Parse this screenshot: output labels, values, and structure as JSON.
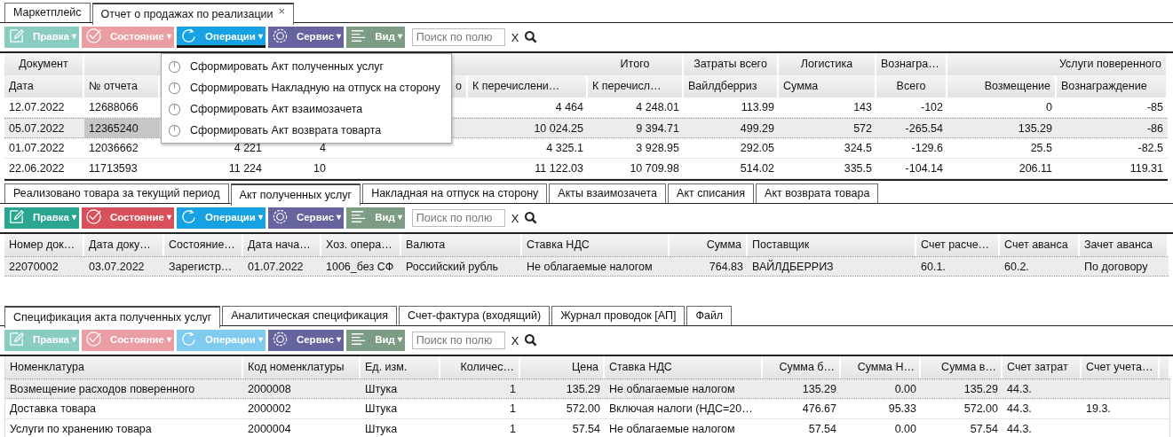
{
  "tabs": [
    {
      "label": "Маркетплейс",
      "selected": false
    },
    {
      "label": "Отчет о продажах по реализации",
      "selected": true,
      "close": "×"
    }
  ],
  "panels": [
    {
      "toolbar": {
        "buttons": [
          {
            "kind": "edit",
            "label": "Правка",
            "caret": "▾",
            "disabled": true,
            "expanded": false
          },
          {
            "kind": "status",
            "label": "Состояние",
            "caret": "▾",
            "disabled": true,
            "expanded": false
          },
          {
            "kind": "operations",
            "label": "Операции",
            "caret": "▾",
            "disabled": false,
            "expanded": true
          },
          {
            "kind": "service",
            "label": "Сервис",
            "caret": "▾",
            "disabled": false,
            "expanded": false
          },
          {
            "kind": "view",
            "label": "Вид",
            "caret": "▾",
            "disabled": false,
            "expanded": false
          }
        ],
        "search": {
          "placeholder": "Поиск по полю",
          "clear": "X"
        }
      },
      "menu": [
        "Сформировать Акт полученных услуг",
        "Сформировать Накладную на отпуск на сторону",
        "Сформировать Акт взаимозачета",
        "Сформировать Акт возврата товарта"
      ],
      "table": {
        "column_groups": [
          "Документ",
          "Итого",
          "Затраты всего",
          "Логистика",
          "Вознагра…",
          "Услуги поверенного"
        ],
        "columns": [
          "Дата",
          "№ отчета",
          null,
          null,
          "о",
          "К перечислени…",
          "К перечисл…",
          "Вайлдберриз",
          "Сумма",
          "Всего",
          "Возмещение",
          "Вознаграждение"
        ],
        "rows": [
          {
            "selected": false,
            "cells": [
              "12.07.2022",
              "12688066",
              null,
              null,
              null,
              "4 464",
              "4 248.01",
              "113.99",
              "143",
              "-102",
              "0",
              "-85"
            ]
          },
          {
            "selected": true,
            "cells": [
              "05.07.2022",
              {
                "text": "12365240",
                "focused": true
              },
              null,
              null,
              null,
              "10 024.25",
              "9 394.71",
              "499.29",
              "572",
              "-265.54",
              "135.29",
              "-86"
            ]
          },
          {
            "selected": false,
            "cells": [
              "01.07.2022",
              "12036662",
              "4 221",
              "4",
              null,
              "4 325.1",
              "3 928.95",
              "292.05",
              "324.5",
              "-129.6",
              "25.5",
              "-82.5"
            ]
          },
          {
            "selected": false,
            "cells": [
              "22.06.2022",
              "11713593",
              "11 224",
              "10",
              null,
              "11 122.03",
              "10 709.98",
              "514.02",
              "335.5",
              "-104.14",
              "206.11",
              "119.31"
            ]
          }
        ]
      }
    },
    {
      "tabs": [
        {
          "label": "Реализовано товара за текущий период",
          "selected": false
        },
        {
          "label": "Акт полученных услуг",
          "selected": true
        },
        {
          "label": "Накладная на отпуск на сторону",
          "selected": false
        },
        {
          "label": "Акты взаимозачета",
          "selected": false
        },
        {
          "label": "Акт списания",
          "selected": false
        },
        {
          "label": "Акт возврата товара",
          "selected": false
        }
      ],
      "toolbar": {
        "buttons": [
          {
            "kind": "edit",
            "label": "Правка",
            "caret": "▾",
            "disabled": false,
            "expanded": false
          },
          {
            "kind": "status",
            "label": "Состояние",
            "caret": "▾",
            "disabled": false,
            "expanded": false
          },
          {
            "kind": "operations",
            "label": "Операции",
            "caret": "▾",
            "disabled": false,
            "expanded": false
          },
          {
            "kind": "service",
            "label": "Сервис",
            "caret": "▾",
            "disabled": false,
            "expanded": false
          },
          {
            "kind": "view",
            "label": "Вид",
            "caret": "▾",
            "disabled": false,
            "expanded": false
          }
        ],
        "search": {
          "placeholder": "Поиск по полю",
          "clear": "X"
        }
      },
      "table": {
        "columns": [
          "Номер док…",
          "Дата доку…",
          "Состояние…",
          "Дата нача…",
          "Хоз. опера…",
          "Валюта",
          "Ставка НДС",
          "Сумма",
          "Поставщик",
          "Счет расче…",
          "Счет аванса",
          "Зачет аванса"
        ],
        "rows": [
          {
            "selected": true,
            "cells": [
              "22070002",
              "03.07.2022",
              "Зарегистр…",
              "01.07.2022",
              "1006_без СФ",
              "Российский рубль",
              "Не облагаемые налогом",
              "764.83",
              "ВАЙЛДБЕРРИЗ",
              "60.1.",
              "60.2.",
              "По договору"
            ]
          }
        ]
      }
    },
    {
      "tabs": [
        {
          "label": "Спецификация акта полученных услуг",
          "selected": true
        },
        {
          "label": "Аналитическая спецификация",
          "selected": false
        },
        {
          "label": "Счет-фактура (входящий)",
          "selected": false
        },
        {
          "label": "Журнал проводок [АП]",
          "selected": false
        },
        {
          "label": "Файл",
          "selected": false
        }
      ],
      "toolbar": {
        "buttons": [
          {
            "kind": "edit",
            "label": "Правка",
            "caret": "▾",
            "disabled": true,
            "expanded": false
          },
          {
            "kind": "status",
            "label": "Состояние",
            "caret": "▾",
            "disabled": true,
            "expanded": false
          },
          {
            "kind": "operations",
            "label": "Операции",
            "caret": "▾",
            "disabled": true,
            "expanded": false
          },
          {
            "kind": "service",
            "label": "Сервис",
            "caret": "▾",
            "disabled": false,
            "expanded": false
          },
          {
            "kind": "view",
            "label": "Вид",
            "caret": "▾",
            "disabled": false,
            "expanded": false
          }
        ],
        "search": {
          "placeholder": "Поиск по полю",
          "clear": "X"
        }
      },
      "table": {
        "columns": [
          "Номенклатура",
          "Код номенклатуры",
          "Ед. изм.",
          "Количес…",
          "Цена",
          "Ставка НДС",
          "Сумма б…",
          "Сумма Н…",
          "Сумма в…",
          "Счет затрат",
          "Счет учета…",
          null
        ],
        "rows": [
          {
            "selected": true,
            "cells": [
              "Возмещение расходов поверенного",
              "2000008",
              "Штука",
              "1",
              "135.29",
              "Не облагаемые налогом",
              "135.29",
              "0.00",
              "135.29",
              "44.3.",
              null,
              null
            ]
          },
          {
            "selected": false,
            "cells": [
              "Доставка товара",
              "2000002",
              "Штука",
              "1",
              "572.00",
              "Включая налоги (НДС=20…",
              "476.67",
              "95.33",
              "572.00",
              "44.3.",
              "19.3.",
              null
            ]
          },
          {
            "selected": false,
            "cells": [
              "Услуги по хранению товара",
              "2000004",
              "Штука",
              "1",
              "57.54",
              "Не облагаемые налогом",
              "57.54",
              "0.00",
              "57.54",
              "44.3.",
              null,
              null
            ]
          }
        ]
      }
    }
  ]
}
